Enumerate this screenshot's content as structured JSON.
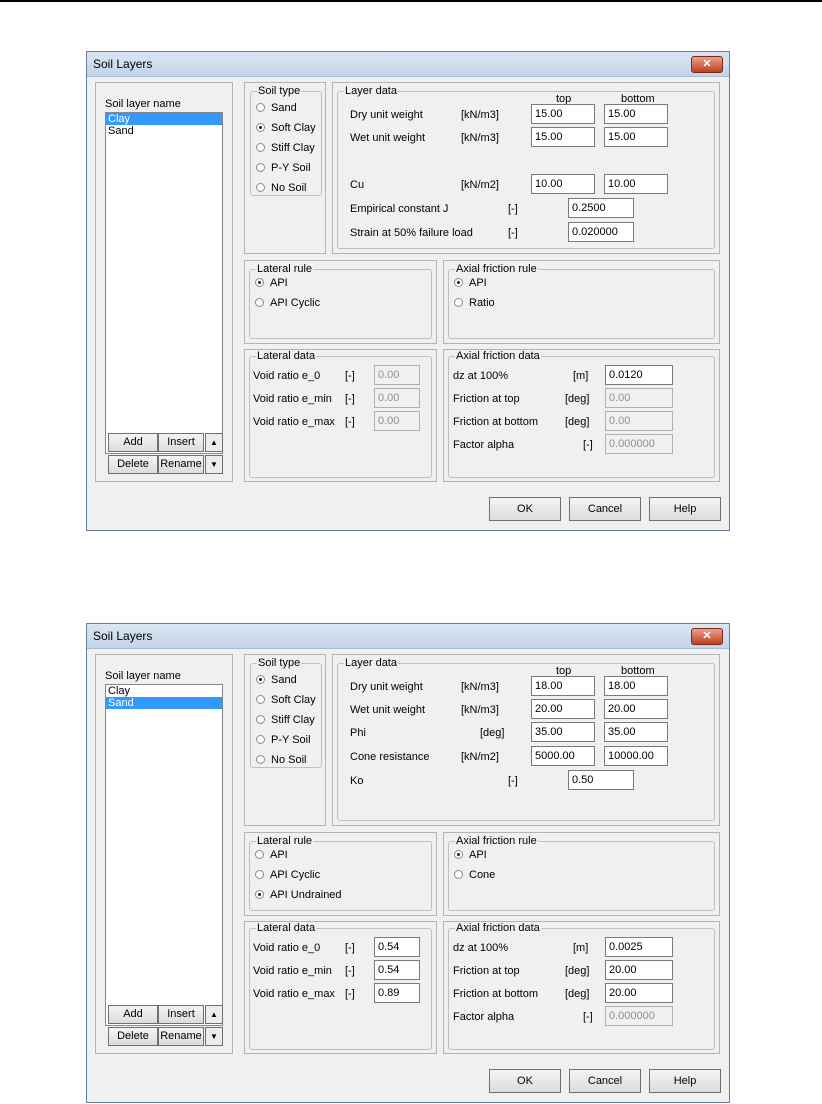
{
  "dialog1": {
    "title": "Soil Layers",
    "close_label": "✕",
    "list_label": "Soil layer name",
    "layers": [
      "Clay",
      "Sand"
    ],
    "buttons": {
      "add": "Add",
      "insert": "Insert",
      "delete": "Delete",
      "rename": "Rename",
      "ok": "OK",
      "cancel": "Cancel",
      "help": "Help"
    },
    "soil_type": {
      "label": "Soil type",
      "options": [
        "Sand",
        "Soft Clay",
        "Stiff Clay",
        "P-Y Soil",
        "No Soil"
      ],
      "selected": "Soft Clay"
    },
    "layer_data": {
      "label": "Layer data",
      "col_top": "top",
      "col_bottom": "bottom",
      "rows": [
        {
          "label": "Dry unit weight",
          "unit": "[kN/m3]",
          "top": "15.00",
          "bottom": "15.00"
        },
        {
          "label": "Wet unit weight",
          "unit": "[kN/m3]",
          "top": "15.00",
          "bottom": "15.00"
        },
        {
          "label": "Cu",
          "unit": "[kN/m2]",
          "top": "10.00",
          "bottom": "10.00"
        }
      ],
      "singles": [
        {
          "label": "Empirical constant J",
          "unit": "[-]",
          "value": "0.2500"
        },
        {
          "label": "Strain at 50% failure load",
          "unit": "[-]",
          "value": "0.020000"
        }
      ]
    },
    "lateral_rule": {
      "label": "Lateral rule",
      "options": [
        "API",
        "API Cyclic"
      ],
      "selected": "API"
    },
    "axial_rule": {
      "label": "Axial friction rule",
      "options": [
        "API",
        "Ratio"
      ],
      "selected": "API"
    },
    "lateral_data": {
      "label": "Lateral data",
      "rows": [
        {
          "label": "Void ratio e_0",
          "unit": "[-]",
          "value": "0.00"
        },
        {
          "label": "Void ratio e_min",
          "unit": "[-]",
          "value": "0.00"
        },
        {
          "label": "Void ratio e_max",
          "unit": "[-]",
          "value": "0.00"
        }
      ]
    },
    "axial_data": {
      "label": "Axial friction data",
      "rows": [
        {
          "label": "dz at 100%",
          "unit": "[m]",
          "value": "0.0120"
        },
        {
          "label": "Friction at top",
          "unit": "[deg]",
          "value": "0.00"
        },
        {
          "label": "Friction at bottom",
          "unit": "[deg]",
          "value": "0.00"
        },
        {
          "label": "Factor alpha",
          "unit": "[-]",
          "value": "0.000000"
        }
      ]
    }
  },
  "dialog2": {
    "title": "Soil Layers",
    "close_label": "✕",
    "list_label": "Soil layer name",
    "layers": [
      "Clay",
      "Sand"
    ],
    "buttons": {
      "add": "Add",
      "insert": "Insert",
      "delete": "Delete",
      "rename": "Rename",
      "ok": "OK",
      "cancel": "Cancel",
      "help": "Help"
    },
    "soil_type": {
      "label": "Soil type",
      "options": [
        "Sand",
        "Soft Clay",
        "Stiff Clay",
        "P-Y Soil",
        "No Soil"
      ],
      "selected": "Sand"
    },
    "layer_data": {
      "label": "Layer data",
      "col_top": "top",
      "col_bottom": "bottom",
      "rows": [
        {
          "label": "Dry unit weight",
          "unit": "[kN/m3]",
          "top": "18.00",
          "bottom": "18.00"
        },
        {
          "label": "Wet unit weight",
          "unit": "[kN/m3]",
          "top": "20.00",
          "bottom": "20.00"
        },
        {
          "label": "Phi",
          "unit": "[deg]",
          "top": "35.00",
          "bottom": "35.00"
        },
        {
          "label": "Cone resistance",
          "unit": "[kN/m2]",
          "top": "5000.00",
          "bottom": "10000.00"
        }
      ],
      "singles": [
        {
          "label": "Ko",
          "unit": "[-]",
          "value": "0.50"
        }
      ]
    },
    "lateral_rule": {
      "label": "Lateral rule",
      "options": [
        "API",
        "API Cyclic",
        "API Undrained"
      ],
      "selected": "API Undrained"
    },
    "axial_rule": {
      "label": "Axial friction rule",
      "options": [
        "API",
        "Cone"
      ],
      "selected": "API"
    },
    "lateral_data": {
      "label": "Lateral data",
      "rows": [
        {
          "label": "Void ratio e_0",
          "unit": "[-]",
          "value": "0.54"
        },
        {
          "label": "Void ratio e_min",
          "unit": "[-]",
          "value": "0.54"
        },
        {
          "label": "Void ratio e_max",
          "unit": "[-]",
          "value": "0.89"
        }
      ]
    },
    "axial_data": {
      "label": "Axial friction data",
      "rows": [
        {
          "label": "dz at 100%",
          "unit": "[m]",
          "value": "0.0025"
        },
        {
          "label": "Friction at top",
          "unit": "[deg]",
          "value": "20.00"
        },
        {
          "label": "Friction at bottom",
          "unit": "[deg]",
          "value": "20.00"
        },
        {
          "label": "Factor alpha",
          "unit": "[-]",
          "value": "0.000000"
        }
      ]
    }
  }
}
